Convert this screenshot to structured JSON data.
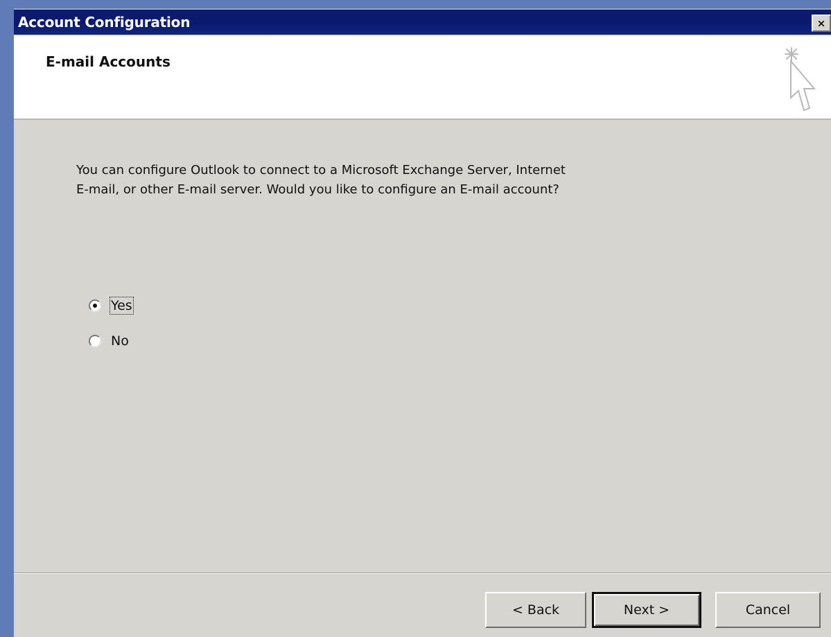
{
  "window": {
    "title": "Account Configuration",
    "close_glyph": "×"
  },
  "header": {
    "title": "E-mail Accounts",
    "icon": "wizard-cursor-icon"
  },
  "content": {
    "description": "You can configure Outlook to connect to a Microsoft Exchange Server, Internet\nE-mail, or other E-mail server.  Would you like to configure an E-mail account?",
    "options": [
      {
        "label": "Yes",
        "selected": true
      },
      {
        "label": "No",
        "selected": false
      }
    ]
  },
  "buttons": {
    "back": "< Back",
    "next": "Next >",
    "cancel": "Cancel"
  },
  "colors": {
    "desktop": "#5f7bb8",
    "titlebar": "#0a1a6f",
    "dialog_face": "#d6d5d0",
    "header_background": "#ffffff"
  }
}
